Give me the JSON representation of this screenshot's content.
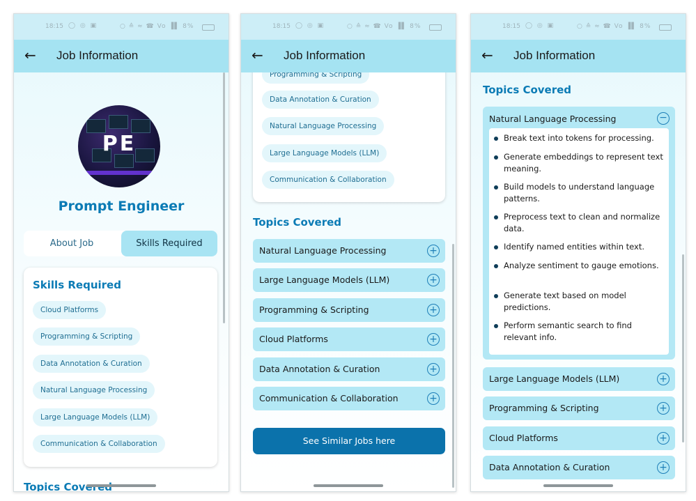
{
  "status": {
    "time": "18:15",
    "left_icons": "◯ ◎ ▣",
    "right_icons": "○ ≙ ≈ ☎ Vo ▐▌ 8%"
  },
  "appbar": {
    "back_icon": "←",
    "title": "Job Information"
  },
  "screen1": {
    "avatar_initials": "PE",
    "job_title": "Prompt Engineer",
    "tabs": [
      "About Job",
      "Skills Required"
    ],
    "skills_title": "Skills Required",
    "skills": [
      "Cloud Platforms",
      "Programming & Scripting",
      "Data Annotation & Curation",
      "Natural Language Processing",
      "Large Language Models (LLM)",
      "Communication & Collaboration"
    ],
    "topics_title_partial": "Topics Covered"
  },
  "screen2": {
    "chips": [
      "Programming & Scripting",
      "Data Annotation & Curation",
      "Natural Language Processing",
      "Large Language Models (LLM)",
      "Communication & Collaboration"
    ],
    "topics_title": "Topics Covered",
    "topics": [
      "Natural Language Processing",
      "Large Language Models (LLM)",
      "Programming & Scripting",
      "Cloud Platforms",
      "Data Annotation & Curation",
      "Communication & Collaboration"
    ],
    "plus_icon": "+",
    "similar_button": "See Similar Jobs here"
  },
  "screen3": {
    "topics_title": "Topics Covered",
    "expanded_topic": "Natural Language Processing",
    "minus_icon": "−",
    "bullets": [
      "Break text into tokens for processing.",
      "Generate embeddings to represent text meaning.",
      "Build models to understand language patterns.",
      "Preprocess text to clean and normalize data.",
      "Identify named entities within text.",
      "Analyze sentiment to gauge emotions.",
      "Generate text based on model predictions.",
      "Perform semantic search to find relevant info."
    ],
    "topics": [
      "Large Language Models (LLM)",
      "Programming & Scripting",
      "Cloud Platforms",
      "Data Annotation & Curation"
    ],
    "plus_icon": "+"
  }
}
